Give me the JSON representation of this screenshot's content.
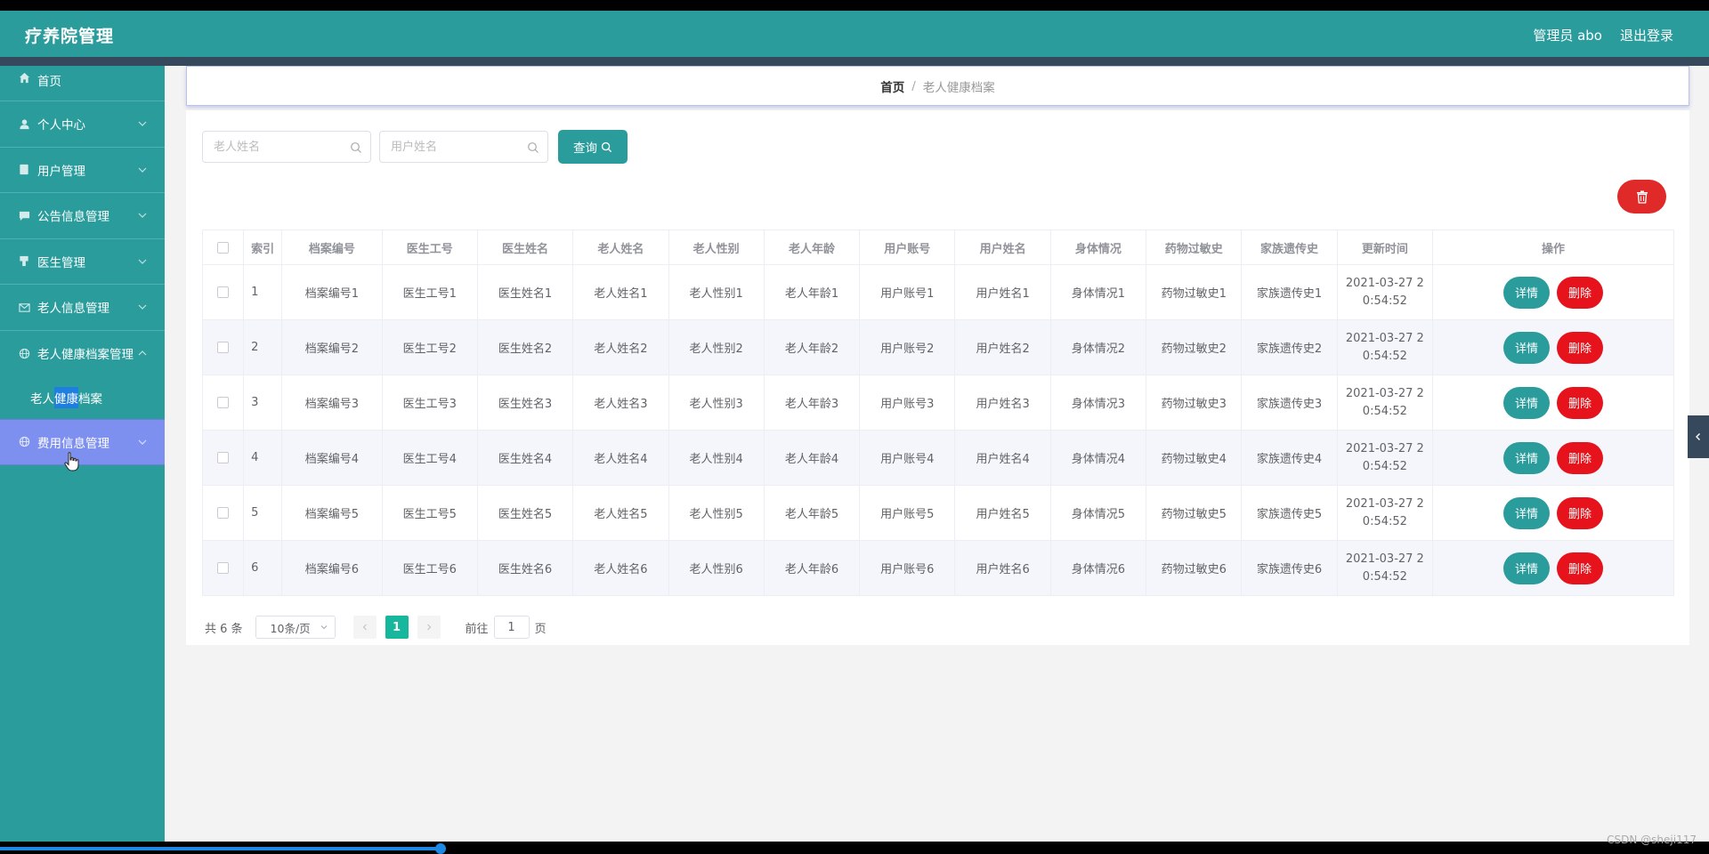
{
  "app": {
    "title": "疗养院管理",
    "admin_label": "管理员 abo",
    "logout_label": "退出登录"
  },
  "sidebar": {
    "items": [
      {
        "label": "首页",
        "icon": "home-icon"
      },
      {
        "label": "个人中心",
        "icon": "user-icon"
      },
      {
        "label": "用户管理",
        "icon": "document-icon"
      },
      {
        "label": "公告信息管理",
        "icon": "message-icon"
      },
      {
        "label": "医生管理",
        "icon": "tag-icon"
      },
      {
        "label": "老人信息管理",
        "icon": "mail-icon"
      },
      {
        "label": "老人健康档案管理",
        "icon": "globe-icon"
      },
      {
        "label": "费用信息管理",
        "icon": "globe-icon"
      }
    ],
    "sub_item": {
      "label_before": "老人",
      "label_highlight": "健康",
      "label_after": "档案"
    }
  },
  "breadcrumb": {
    "home": "首页",
    "separator": "/",
    "current": "老人健康档案"
  },
  "search": {
    "elder_name_placeholder": "老人姓名",
    "user_name_placeholder": "用户姓名",
    "query_label": "查询"
  },
  "table": {
    "headers": [
      "索引",
      "档案编号",
      "医生工号",
      "医生姓名",
      "老人姓名",
      "老人性别",
      "老人年龄",
      "用户账号",
      "用户姓名",
      "身体情况",
      "药物过敏史",
      "家族遗传史",
      "更新时间",
      "操作"
    ],
    "rows": [
      {
        "index": "1",
        "archive_no": "档案编号1",
        "doctor_id": "医生工号1",
        "doctor_name": "医生姓名1",
        "elder_name": "老人姓名1",
        "elder_gender": "老人性别1",
        "elder_age": "老人年龄1",
        "user_account": "用户账号1",
        "user_name": "用户姓名1",
        "body": "身体情况1",
        "allergy": "药物过敏史1",
        "heredity": "家族遗传史1",
        "time_line1": "2021-03-27 2",
        "time_line2": "0:54:52"
      },
      {
        "index": "2",
        "archive_no": "档案编号2",
        "doctor_id": "医生工号2",
        "doctor_name": "医生姓名2",
        "elder_name": "老人姓名2",
        "elder_gender": "老人性别2",
        "elder_age": "老人年龄2",
        "user_account": "用户账号2",
        "user_name": "用户姓名2",
        "body": "身体情况2",
        "allergy": "药物过敏史2",
        "heredity": "家族遗传史2",
        "time_line1": "2021-03-27 2",
        "time_line2": "0:54:52"
      },
      {
        "index": "3",
        "archive_no": "档案编号3",
        "doctor_id": "医生工号3",
        "doctor_name": "医生姓名3",
        "elder_name": "老人姓名3",
        "elder_gender": "老人性别3",
        "elder_age": "老人年龄3",
        "user_account": "用户账号3",
        "user_name": "用户姓名3",
        "body": "身体情况3",
        "allergy": "药物过敏史3",
        "heredity": "家族遗传史3",
        "time_line1": "2021-03-27 2",
        "time_line2": "0:54:52"
      },
      {
        "index": "4",
        "archive_no": "档案编号4",
        "doctor_id": "医生工号4",
        "doctor_name": "医生姓名4",
        "elder_name": "老人姓名4",
        "elder_gender": "老人性别4",
        "elder_age": "老人年龄4",
        "user_account": "用户账号4",
        "user_name": "用户姓名4",
        "body": "身体情况4",
        "allergy": "药物过敏史4",
        "heredity": "家族遗传史4",
        "time_line1": "2021-03-27 2",
        "time_line2": "0:54:52"
      },
      {
        "index": "5",
        "archive_no": "档案编号5",
        "doctor_id": "医生工号5",
        "doctor_name": "医生姓名5",
        "elder_name": "老人姓名5",
        "elder_gender": "老人性别5",
        "elder_age": "老人年龄5",
        "user_account": "用户账号5",
        "user_name": "用户姓名5",
        "body": "身体情况5",
        "allergy": "药物过敏史5",
        "heredity": "家族遗传史5",
        "time_line1": "2021-03-27 2",
        "time_line2": "0:54:52"
      },
      {
        "index": "6",
        "archive_no": "档案编号6",
        "doctor_id": "医生工号6",
        "doctor_name": "医生姓名6",
        "elder_name": "老人姓名6",
        "elder_gender": "老人性别6",
        "elder_age": "老人年龄6",
        "user_account": "用户账号6",
        "user_name": "用户姓名6",
        "body": "身体情况6",
        "allergy": "药物过敏史6",
        "heredity": "家族遗传史6",
        "time_line1": "2021-03-27 2",
        "time_line2": "0:54:52"
      }
    ],
    "detail_label": "详情",
    "delete_label": "删除"
  },
  "pagination": {
    "total_label": "共 6 条",
    "page_size": "10条/页",
    "current_page": "1",
    "goto_label": "前往",
    "goto_value": "1",
    "page_suffix": "页"
  },
  "watermark": "CSDN @sheji117",
  "colors": {
    "primary": "#2a9c9c",
    "danger": "#e6131c",
    "active_page": "#17b79e",
    "hover_menu": "#7d90f0"
  }
}
